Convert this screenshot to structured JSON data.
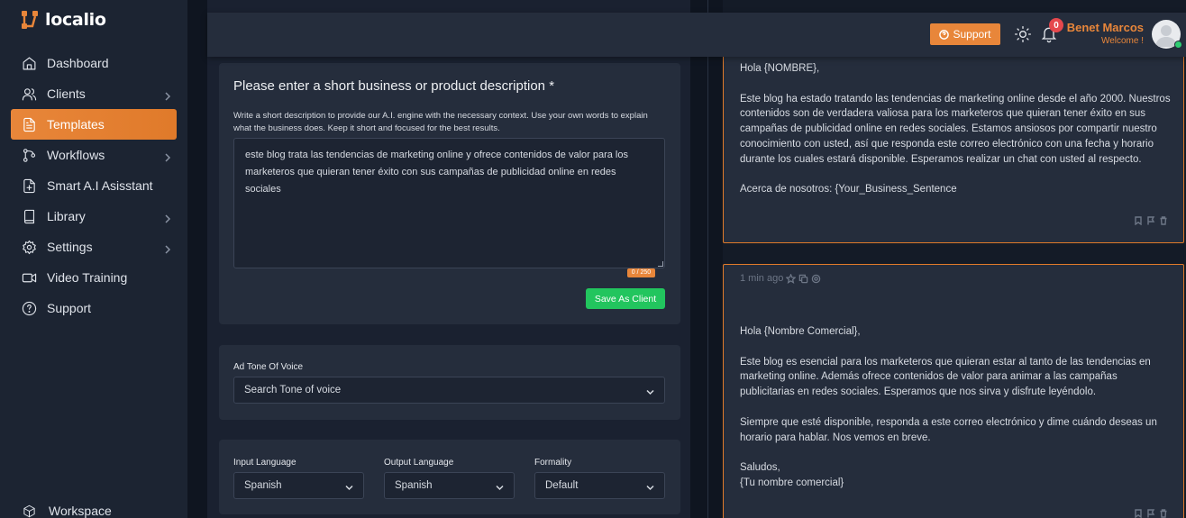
{
  "brand": {
    "name": "localio",
    "accent": "#e8863a"
  },
  "sidebar": {
    "items": [
      {
        "label": "Dashboard",
        "icon": "home-icon"
      },
      {
        "label": "Clients",
        "icon": "users-icon"
      },
      {
        "label": "Templates",
        "icon": "file-text-icon",
        "active": true
      },
      {
        "label": "Workflows",
        "icon": "git-branch-icon"
      },
      {
        "label": "Smart A.I Asisstant",
        "icon": "file-plus-icon"
      },
      {
        "label": "Library",
        "icon": "book-icon"
      },
      {
        "label": "Settings",
        "icon": "gear-icon"
      },
      {
        "label": "Video Training",
        "icon": "video-icon"
      },
      {
        "label": "Support",
        "icon": "help-icon"
      }
    ],
    "workspace_label": "Workspace"
  },
  "header": {
    "support_label": "Support",
    "notification_count": "0",
    "user_name": "Benet Marcos",
    "welcome": "Welcome !"
  },
  "form": {
    "description_title": "Please enter a short business or product description *",
    "description_help": "Write a short description to provide our A.I. engine with the necessary context. Use your own words to explain what the business does. Keep it short and focused for the best results.",
    "description_value": "este blog trata las tendencias de marketing online y ofrece contenidos de valor para los marketeros que quieran tener éxito con sus campañas de publicidad online en redes sociales",
    "char_counter": "0 / 250",
    "save_label": "Save As Client",
    "tone_label": "Ad Tone Of Voice",
    "tone_placeholder": "Search Tone of voice",
    "input_language_label": "Input Language",
    "input_language_value": "Spanish",
    "output_language_label": "Output Language",
    "output_language_value": "Spanish",
    "formality_label": "Formality",
    "formality_value": "Default"
  },
  "results": [
    {
      "paragraphs": [
        "Hola {NOMBRE},",
        "Este blog ha estado tratando las tendencias de marketing online desde el año 2000. Nuestros contenidos son de verdadera valiosa para los marketeros que quieran tener éxito en sus campañas de publicidad online en redes sociales. Estamos ansiosos por compartir nuestro conocimiento con usted, así que responda este correo electrónico con una fecha y horario durante los cuales estará disponible. Esperamos realizar un chat con usted al respecto.",
        "Acerca de nosotros: {Your_Business_Sentence"
      ]
    },
    {
      "time": "1 min ago",
      "paragraphs": [
        "Hola {Nombre Comercial},",
        "Este blog es esencial para los marketeros que quieran estar al tanto de las tendencias en marketing online. Además ofrece contenidos de valor para animar a las campañas publicitarias en redes sociales. Esperamos que nos sirva y disfrute leyéndolo.",
        "Siempre que esté disponible, responda a este correo electrónico y dime cuándo deseas un horario para hablar. Nos vemos en breve.",
        "Saludos,\n{Tu nombre comercial}"
      ]
    }
  ]
}
